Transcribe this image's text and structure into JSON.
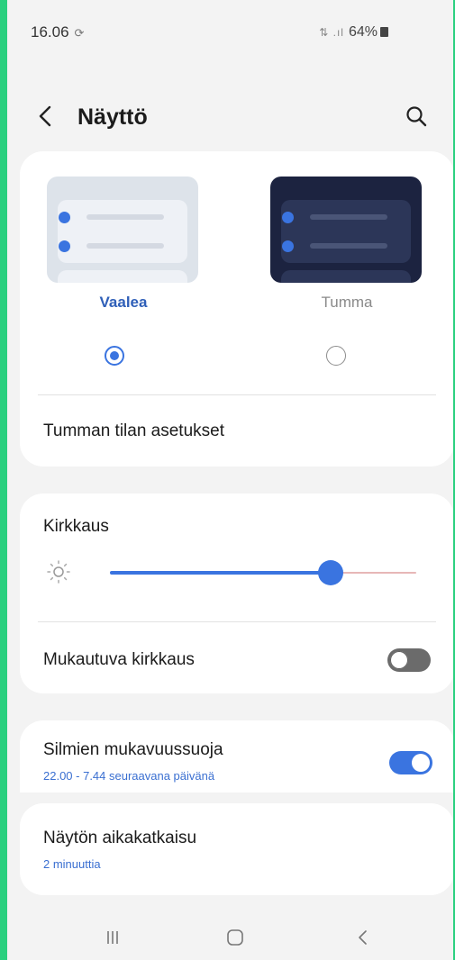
{
  "status_bar": {
    "time": "16.06",
    "sync_icon": "sync-icon",
    "signal_text": "⇅ .ıl",
    "battery": "64%"
  },
  "header": {
    "title": "Näyttö"
  },
  "theme": {
    "light_label": "Vaalea",
    "dark_label": "Tumma",
    "selected": "light"
  },
  "dark_settings_label": "Tumman tilan asetukset",
  "brightness": {
    "label": "Kirkkaus",
    "level": 0.72,
    "adaptive_label": "Mukautuva kirkkaus",
    "adaptive_on": false
  },
  "eye_comfort": {
    "label": "Silmien mukavuussuoja",
    "schedule": "22.00 - 7.44 seuraavana päivänä",
    "on": true
  },
  "screen_timeout": {
    "label": "Näytön aikakatkaisu",
    "value": "2 minuuttia"
  },
  "colors": {
    "accent": "#3a74e0",
    "background": "#f3f3f3",
    "frame": "#2ad07f"
  }
}
